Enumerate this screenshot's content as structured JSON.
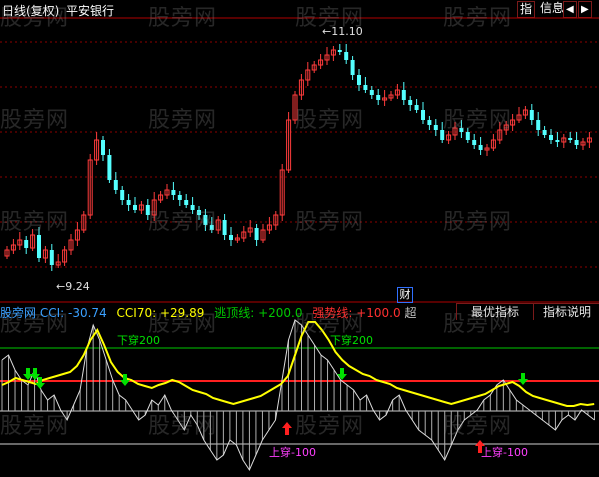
{
  "header": {
    "period": "日线(复权)",
    "stock_name": "平安银行",
    "btn_index": "指",
    "btn_info": "信息",
    "btn_nav_left": "◀",
    "btn_nav_right": "▶"
  },
  "watermark": "股旁网",
  "price_panel": {
    "high_label": "11.10",
    "low_label": "9.24",
    "marker": "财"
  },
  "indicator_panel": {
    "source": "股旁网",
    "cci_label": "CCI:",
    "cci_value": "-30.74",
    "cci70_label": "CCI70:",
    "cci70_value": "+29.89",
    "escape_label": "逃顶线:",
    "escape_value": "+200.0",
    "strong_label": "强势线:",
    "strong_value": "+100.0",
    "trailing": "超",
    "tab_best": "最优指标",
    "tab_help": "指标说明",
    "cross_down_200_a": "下穿200",
    "cross_down_200_b": "下穿200",
    "cross_up_100_a": "上穿-100",
    "cross_up_100_b": "上穿-100"
  },
  "colors": {
    "up_candle": "#ff3c3c",
    "down_candle": "#54ffff",
    "cci_line": "#dcdcdc",
    "cci70_line": "#ffff00",
    "escape_line": "#00c800",
    "strong_line": "#ff2020",
    "sell_arrow": "#00e000",
    "buy_arrow": "#ff2020",
    "grid": "#8b0000"
  }
}
